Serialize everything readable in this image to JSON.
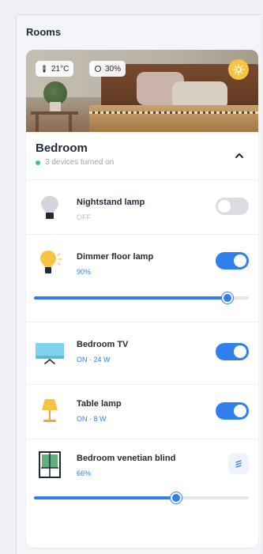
{
  "section": {
    "title": "Rooms"
  },
  "room": {
    "name": "Bedroom",
    "subtitle": "3 devices turned on",
    "chips": {
      "temperature": "21°C",
      "humidity": "30%"
    }
  },
  "devices": [
    {
      "name": "Nightstand lamp",
      "status": "OFF",
      "on": false,
      "icon": "bulb-icon"
    },
    {
      "name": "Dimmer floor lamp",
      "status": "90%",
      "on": true,
      "icon": "floor-lamp-icon",
      "level": 0.9
    },
    {
      "name": "Bedroom TV",
      "status": "ON · 24 W",
      "on": true,
      "icon": "tv-icon"
    },
    {
      "name": "Table lamp",
      "status": "ON · 8 W",
      "on": true,
      "icon": "table-lamp-icon"
    },
    {
      "name": "Bedroom venetian blind",
      "status": "66%",
      "icon": "blind-icon",
      "level": 0.66
    }
  ],
  "colors": {
    "accent": "#2f80ed",
    "online": "#3fc380",
    "sun": "#f6c343"
  }
}
